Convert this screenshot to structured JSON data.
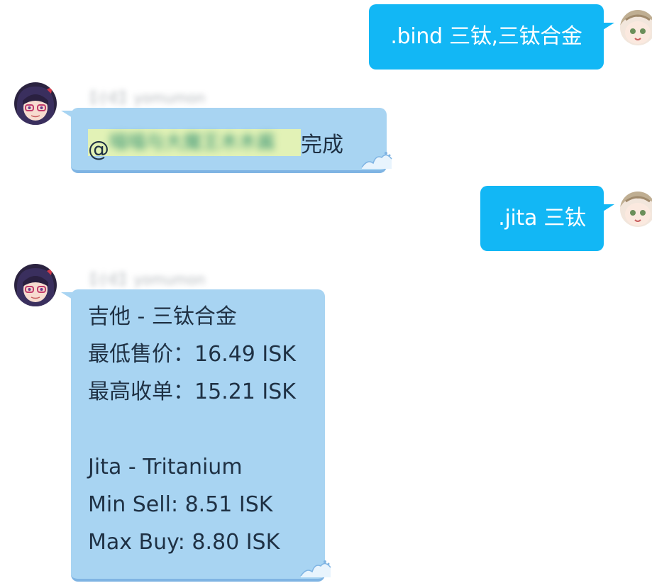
{
  "messages": [
    {
      "side": "out",
      "text": ".bind 三钛,三钛合金"
    },
    {
      "side": "in",
      "sender": "【小E】yomumon",
      "mention_prefix": "@",
      "mention_name": "喵喵与大魔王木木酱",
      "mention_suffix": "完成"
    },
    {
      "side": "out",
      "text": ".jita 三钛"
    },
    {
      "side": "in",
      "sender": "【小E】yomumon",
      "lines": [
        "吉他 - 三钛合金",
        "最低售价：16.49 ISK",
        "最高收单：15.21 ISK",
        "",
        "Jita - Tritanium",
        "Min Sell: 8.51 ISK",
        "Max Buy: 8.80 ISK"
      ]
    }
  ],
  "colors": {
    "outgoing_bubble": "#12b7f5",
    "incoming_bubble": "#a8d4f2",
    "incoming_text": "#1f3144",
    "mention_highlight": "#e2f2b6"
  }
}
